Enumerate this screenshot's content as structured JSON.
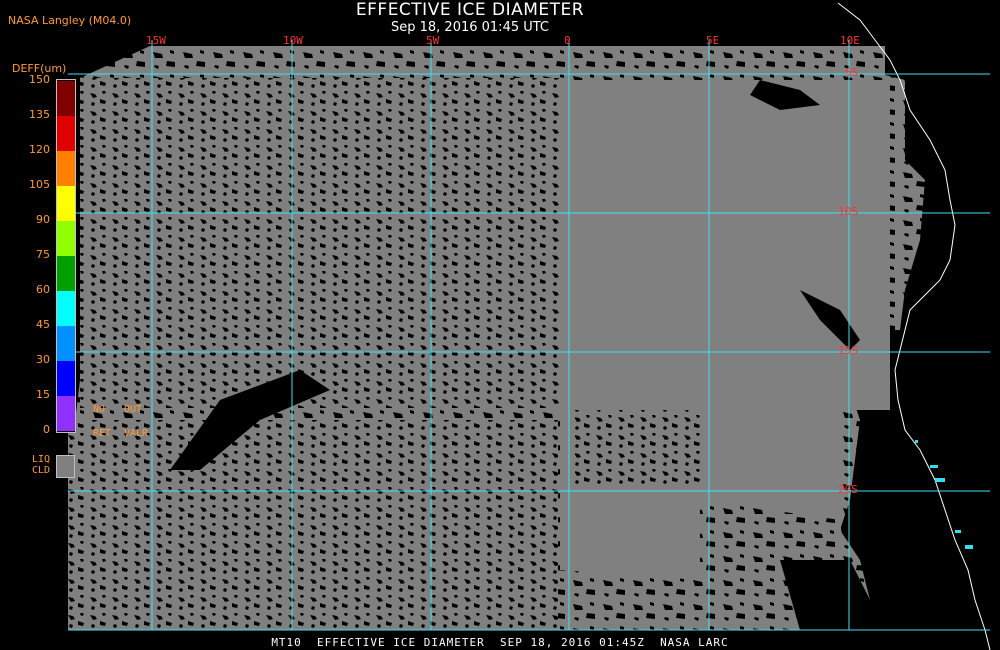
{
  "header": {
    "title": "EFFECTIVE ICE DIAMETER",
    "subtitle": "Sep 18, 2016 01:45 UTC",
    "provider": "NASA Langley (M04.0)"
  },
  "legend": {
    "unit_label": "DEFF(um)",
    "tick_labels": [
      "150",
      "135",
      "120",
      "105",
      "90",
      "75",
      "60",
      "45",
      "30",
      "15",
      "0"
    ],
    "colors": [
      "#800000",
      "#e00000",
      "#ff8000",
      "#ffff00",
      "#90ff00",
      "#00a000",
      "#00ffff",
      "#0090ff",
      "#0000ff",
      "#9030ff"
    ],
    "no_ret": [
      "NO",
      "RET"
    ],
    "out_valr": [
      "OUT",
      "VALR"
    ],
    "liq_cld": [
      "LIQ",
      "CLD"
    ],
    "liq_color": "#808080"
  },
  "map": {
    "longitude_labels": [
      "15W",
      "10W",
      "5W",
      "0",
      "5E",
      "10E"
    ],
    "latitude_labels": [
      "5S",
      "10S",
      "15S",
      "20S"
    ],
    "grid_color": "#40e0f0",
    "cloud_color": "#808080",
    "coast_color": "#ffffff"
  },
  "footer": {
    "text": "MT10  EFFECTIVE ICE DIAMETER  SEP 18, 2016 01:45Z  NASA LARC"
  }
}
